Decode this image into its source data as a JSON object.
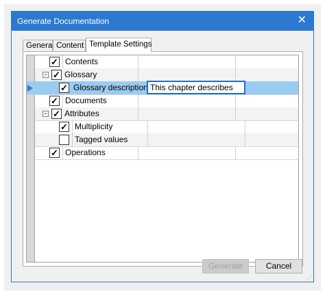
{
  "window": {
    "title": "Generate Documentation"
  },
  "tabs": [
    {
      "label": "General"
    },
    {
      "label": "Content"
    },
    {
      "label": "Template Settings",
      "active": true
    }
  ],
  "rows": [
    {
      "label": "Contents",
      "checked": true
    },
    {
      "label": "Glossary",
      "checked": true,
      "expanded": true
    },
    {
      "label": "Glossary description:",
      "checked": true,
      "value": "This chapter describes",
      "selected": true
    },
    {
      "label": "Documents",
      "checked": true
    },
    {
      "label": "Attributes",
      "checked": true,
      "expanded": true
    },
    {
      "label": "Multiplicity",
      "checked": true
    },
    {
      "label": "Tagged values",
      "checked": false
    },
    {
      "label": "Operations",
      "checked": true
    }
  ],
  "buttons": {
    "generate": "Generate",
    "cancel": "Cancel"
  },
  "glyphs": {
    "close": "✕",
    "check": "✓",
    "collapse": "−",
    "grip": "⋰"
  },
  "colors": {
    "accent": "#2b79d0",
    "selection": "#99ccf0"
  }
}
